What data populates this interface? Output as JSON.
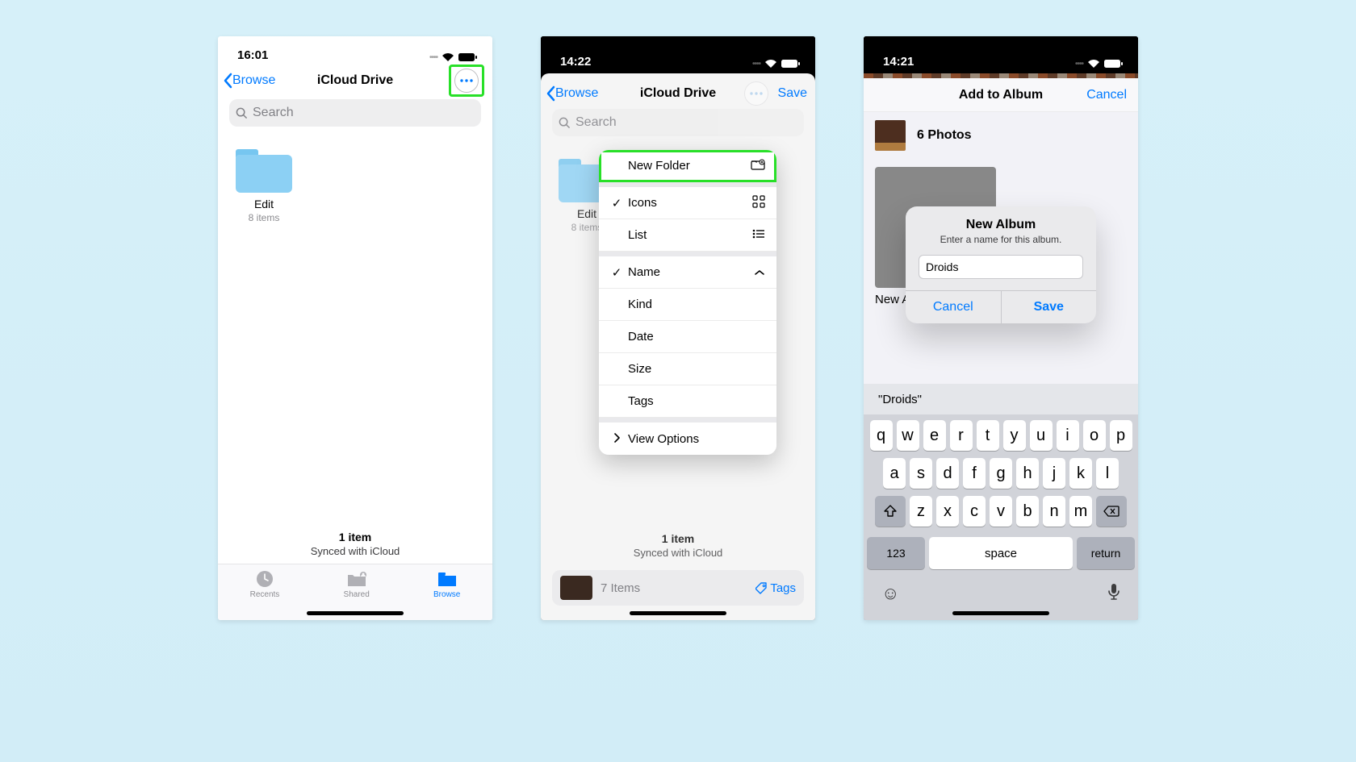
{
  "phone1": {
    "time": "16:01",
    "back": "Browse",
    "title": "iCloud Drive",
    "search_placeholder": "Search",
    "folder": {
      "name": "Edit",
      "sub": "8 items"
    },
    "summary": {
      "count": "1 item",
      "sync": "Synced with iCloud"
    },
    "tabs": {
      "recents": "Recents",
      "shared": "Shared",
      "browse": "Browse"
    }
  },
  "phone2": {
    "time": "14:22",
    "back": "Browse",
    "title": "iCloud Drive",
    "save": "Save",
    "search_placeholder": "Search",
    "folder": {
      "name": "Edit",
      "sub": "8 items"
    },
    "menu": {
      "new_folder": "New Folder",
      "icons": "Icons",
      "list": "List",
      "name": "Name",
      "kind": "Kind",
      "date": "Date",
      "size": "Size",
      "tags": "Tags",
      "view_options": "View Options"
    },
    "summary": {
      "count": "1 item",
      "sync": "Synced with iCloud"
    },
    "drop": {
      "items": "7 Items",
      "tags": "Tags"
    }
  },
  "phone3": {
    "time": "14:21",
    "header": "Add to Album",
    "cancel": "Cancel",
    "count": "6 Photos",
    "album_label": "New Album…",
    "dialog": {
      "title": "New Album",
      "sub": "Enter a name for this album.",
      "value": "Droids",
      "cancel": "Cancel",
      "save": "Save"
    },
    "suggestion": "\"Droids\"",
    "keyboard": {
      "row1": [
        "q",
        "w",
        "e",
        "r",
        "t",
        "y",
        "u",
        "i",
        "o",
        "p"
      ],
      "row2": [
        "a",
        "s",
        "d",
        "f",
        "g",
        "h",
        "j",
        "k",
        "l"
      ],
      "row3": [
        "z",
        "x",
        "c",
        "v",
        "b",
        "n",
        "m"
      ],
      "num": "123",
      "space": "space",
      "return": "return"
    }
  }
}
